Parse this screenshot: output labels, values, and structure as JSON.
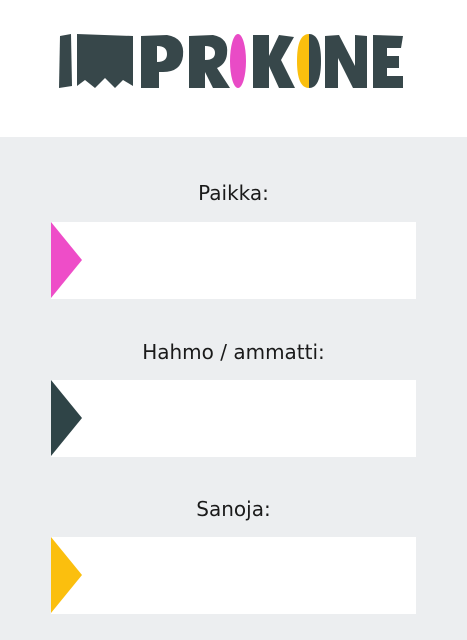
{
  "logo": {
    "text": "IMPROKONE",
    "colors": {
      "dark": "#37474a",
      "pink": "#e94bc6",
      "yellow": "#fbbf0e"
    }
  },
  "fields": [
    {
      "label": "Paikka:",
      "value": "",
      "marker_color": "#ee4dc8"
    },
    {
      "label": "Hahmo / ammatti:",
      "value": "",
      "marker_color": "#2f4447"
    },
    {
      "label": "Sanoja:",
      "value": "",
      "marker_color": "#fbbf0e"
    }
  ]
}
